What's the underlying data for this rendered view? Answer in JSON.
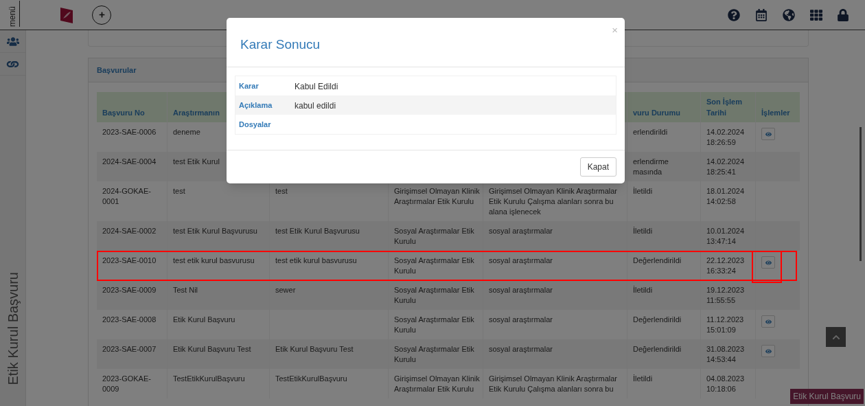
{
  "topbar": {
    "menu_label": "menü"
  },
  "sidebar": {
    "vertical_title": "Etik Kurul Başvuru"
  },
  "panel": {
    "title": "Başvurular"
  },
  "table": {
    "columns": [
      {
        "label": "Başvuru No"
      },
      {
        "label": "Araştırmanın"
      },
      {},
      {},
      {},
      {
        "label": "vuru Durumu"
      },
      {
        "label": "Son İşlem Tarihi"
      },
      {
        "label": "İşlemler"
      }
    ],
    "rows": [
      {
        "cells": [
          {
            "text": "2023-SAE-0006"
          },
          {
            "text": "deneme"
          },
          {},
          {},
          {},
          {
            "text": "erlendirildi"
          },
          {
            "text": "14.02.2024 18:26:59"
          }
        ],
        "view_button": true,
        "highlighted": false
      },
      {
        "cells": [
          {
            "text": "2024-SAE-0004"
          },
          {
            "text": "test Etik Kurul"
          },
          {},
          {},
          {},
          {
            "text": "erlendirme masında"
          },
          {
            "text": "14.02.2024 18:25:41"
          }
        ],
        "view_button": false,
        "highlighted": false
      },
      {
        "cells": [
          {
            "text": "2024-GOKAE-0001"
          },
          {
            "text": "test"
          },
          {
            "text": "test"
          },
          {
            "text": "Girişimsel Olmayan Klinik Araştırmalar Etik Kurulu"
          },
          {
            "text": "Girişimsel Olmayan Klinik Araştırmalar Etik Kurulu Çalışma alanları sonra bu alana işlenecek"
          },
          {
            "text": "İletildi"
          },
          {
            "text": "18.01.2024 14:02:58"
          }
        ],
        "view_button": false,
        "highlighted": false
      },
      {
        "cells": [
          {
            "text": "2024-SAE-0002"
          },
          {
            "text": "test Etik Kurul Başvurusu"
          },
          {
            "text": "test Etik Kurul Başvurusu"
          },
          {
            "text": "Sosyal Araştırmalar Etik Kurulu"
          },
          {
            "text": "sosyal araştırmalar"
          },
          {
            "text": "İletildi"
          },
          {
            "text": "10.01.2024 13:47:14"
          }
        ],
        "view_button": false,
        "highlighted": false
      },
      {
        "cells": [
          {
            "text": "2023-SAE-0010"
          },
          {
            "text": "test etik kurul basvurusu"
          },
          {
            "text": "test etik kurul basvurusu"
          },
          {
            "text": "Sosyal Araştırmalar Etik Kurulu"
          },
          {
            "text": "sosyal araştırmalar"
          },
          {
            "text": "Değerlendirildi"
          },
          {
            "text": "22.12.2023 16:33:24"
          }
        ],
        "view_button": true,
        "highlighted": true
      },
      {
        "cells": [
          {
            "text": "2023-SAE-0009"
          },
          {
            "text": "Test Nil"
          },
          {
            "text": "sewer"
          },
          {
            "text": "Sosyal Araştırmalar Etik Kurulu"
          },
          {
            "text": "sosyal araştırmalar"
          },
          {
            "text": "İletildi"
          },
          {
            "text": "19.12.2023 11:55:55"
          }
        ],
        "view_button": false,
        "highlighted": false
      },
      {
        "cells": [
          {
            "text": "2023-SAE-0008"
          },
          {
            "text": "Etik Kurul Başvuru"
          },
          {},
          {
            "text": "Sosyal Araştırmalar Etik Kurulu"
          },
          {
            "text": "sosyal araştırmalar"
          },
          {
            "text": "Değerlendirildi"
          },
          {
            "text": "11.12.2023 15:01:09"
          }
        ],
        "view_button": true,
        "highlighted": false
      },
      {
        "cells": [
          {
            "text": "2023-SAE-0007"
          },
          {
            "text": "Etik Kurul Başvuru Test"
          },
          {
            "text": "Etik Kurul Başvuru Test"
          },
          {
            "text": "Sosyal Araştırmalar Etik Kurulu"
          },
          {
            "text": "sosyal araştırmalar"
          },
          {
            "text": "Değerlendirildi"
          },
          {
            "text": "31.08.2023 14:53:44"
          }
        ],
        "view_button": true,
        "highlighted": false
      },
      {
        "cells": [
          {
            "text": "2023-GOKAE-0009"
          },
          {
            "text": "TestEtikKurulBaşvuru"
          },
          {
            "text": "TestEtikKurulBaşvuru"
          },
          {
            "text": "Girişimsel Olmayan Klinik Araştırmalar Etik Kurulu"
          },
          {
            "text": "Girişimsel Olmayan Klinik Araştırmalar Etik Kurulu Çalışma alanları sonra bu"
          },
          {
            "text": "İletildi"
          },
          {
            "text": "04.08.2023 10:18:06"
          }
        ],
        "view_button": false,
        "highlighted": false
      }
    ]
  },
  "floating_tag": "Etik Kurul Başvuru",
  "modal": {
    "title": "Karar Sonucu",
    "close": "×",
    "fields": [
      {
        "label": "Karar",
        "value": "Kabul Edildi"
      },
      {
        "label": "Açıklama",
        "value": "kabul edildi"
      },
      {
        "label": "Dosyalar"
      }
    ],
    "buttons": [
      "Kapat"
    ]
  }
}
